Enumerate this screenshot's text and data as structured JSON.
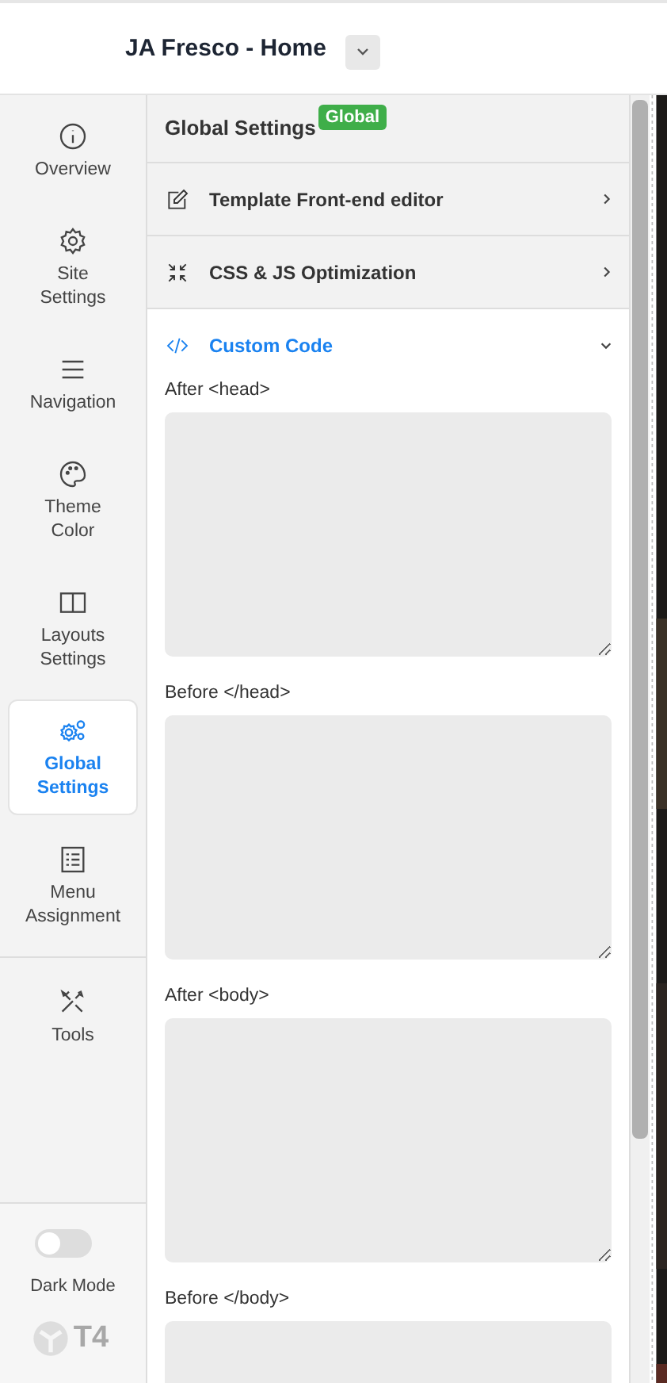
{
  "header": {
    "title": "JA Fresco - Home"
  },
  "sidebar": {
    "items": [
      {
        "label": "Overview",
        "selected": false
      },
      {
        "label": "Site Settings",
        "selected": false
      },
      {
        "label": "Navigation",
        "selected": false
      },
      {
        "label": "Theme Color",
        "selected": false
      },
      {
        "label": "Layouts Settings",
        "selected": false
      },
      {
        "label": "Global Settings",
        "selected": true
      },
      {
        "label": "Menu Assignment",
        "selected": false
      },
      {
        "label": "Tools",
        "selected": false
      }
    ],
    "dark_mode": {
      "label": "Dark Mode",
      "on": false
    },
    "logo": "T4"
  },
  "panel": {
    "title": "Global Settings",
    "badge": "Global",
    "sections": [
      {
        "label": "Template Front-end editor",
        "expanded": false
      },
      {
        "label": "CSS & JS Optimization",
        "expanded": false
      },
      {
        "label": "Custom Code",
        "expanded": true,
        "fields": [
          {
            "label": "After <head>"
          },
          {
            "label": "Before </head>"
          },
          {
            "label": "After <body>"
          },
          {
            "label": "Before </body>"
          }
        ]
      }
    ]
  }
}
